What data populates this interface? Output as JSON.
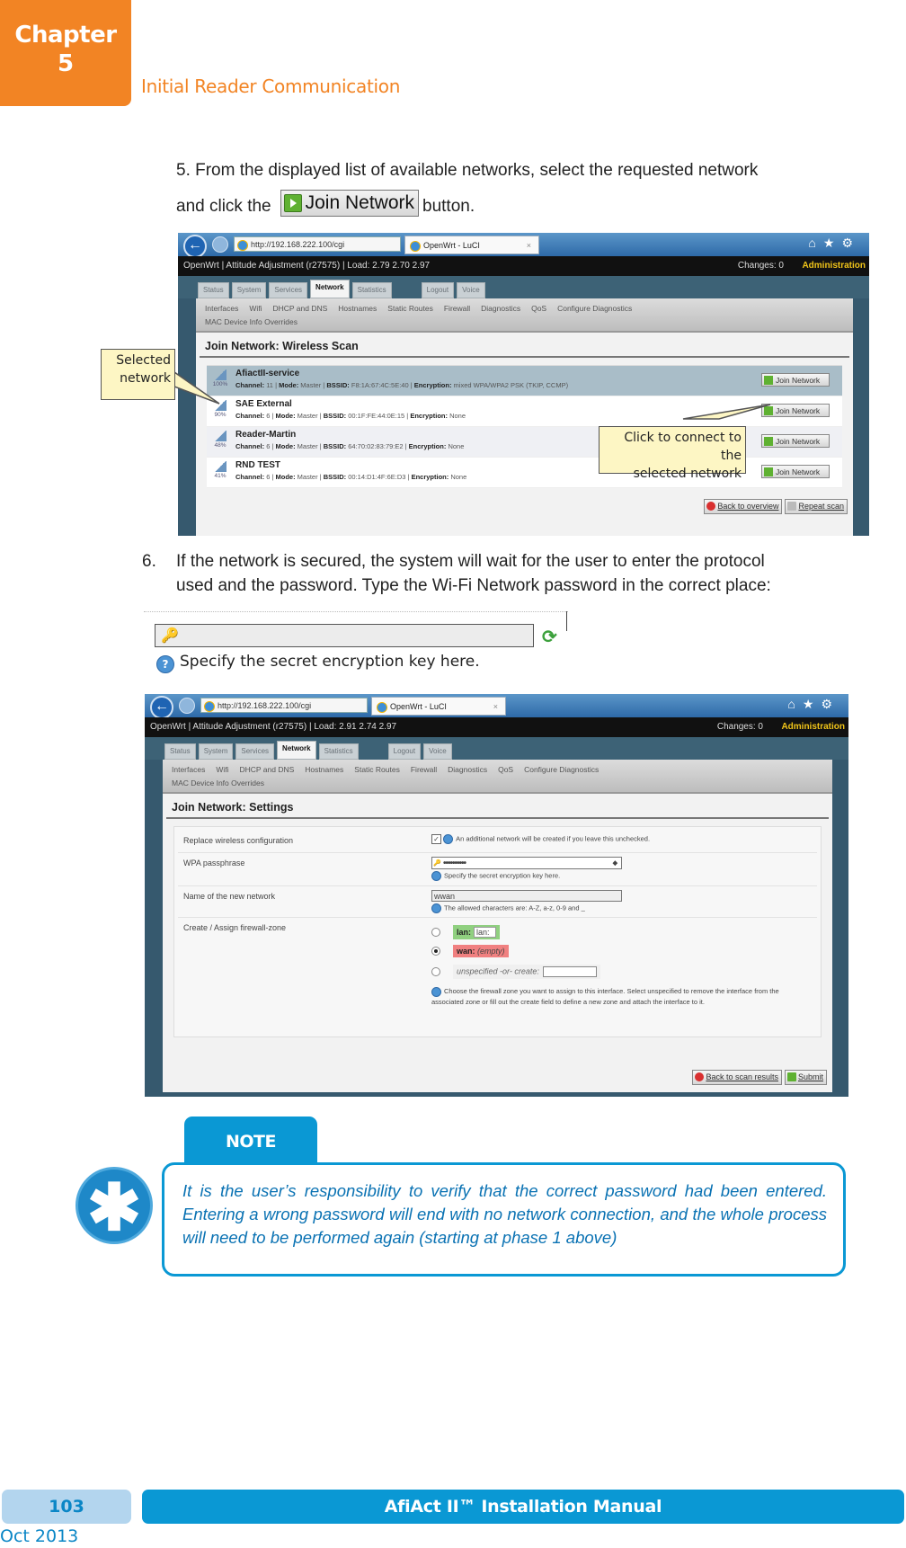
{
  "header": {
    "chapter_label": "Chapter",
    "chapter_number": "5",
    "section_title": "Initial Reader Communication"
  },
  "step5": {
    "text_line1": "5. From the displayed list of available networks, select the requested network",
    "text_before_button": "and click the",
    "button_label": "Join Network",
    "text_after_button": "button."
  },
  "scan_screenshot": {
    "browser": {
      "address": "http://192.168.222.100/cgi",
      "tab_title": "OpenWrt - LuCI",
      "tab_close": "×",
      "icons": [
        "home-icon",
        "star-icon",
        "gear-icon"
      ]
    },
    "status_bar": {
      "text": "OpenWrt | Attitude Adjustment (r27575) | Load: 2.79 2.70 2.97",
      "changes": "Changes: 0",
      "admin": "Administration"
    },
    "main_tabs": [
      "Status",
      "System",
      "Services",
      "Network",
      "Statistics",
      "Logout",
      "Voice"
    ],
    "active_tab": "Network",
    "subnav": [
      "Interfaces",
      "Wifi",
      "DHCP and DNS",
      "Hostnames",
      "Static Routes",
      "Firewall",
      "Diagnostics",
      "QoS",
      "Configure Diagnostics",
      "MAC Device Info Overrides"
    ],
    "page_title": "Join Network: Wireless Scan",
    "networks": [
      {
        "signal": "100%",
        "name": "AfiactII-service",
        "channel": "11",
        "mode": "Master",
        "bssid": "F8:1A:67:4C:5E:40",
        "encryption": "mixed WPA/WPA2 PSK (TKIP, CCMP)",
        "selected": true
      },
      {
        "signal": "90%",
        "name": "SAE External",
        "channel": "6",
        "mode": "Master",
        "bssid": "00:1F:FE:44:0E:15",
        "encryption": "None",
        "selected": false
      },
      {
        "signal": "48%",
        "name": "Reader-Martin",
        "channel": "6",
        "mode": "Master",
        "bssid": "64:70:02:83:79:E2",
        "encryption": "None",
        "selected": false
      },
      {
        "signal": "41%",
        "name": "RND TEST",
        "channel": "6",
        "mode": "Master",
        "bssid": "00:14:D1:4F:6E:D3",
        "encryption": "None",
        "selected": false
      }
    ],
    "labels": {
      "channel": "Channel:",
      "mode": "Mode:",
      "bssid": "BSSID:",
      "encryption": "Encryption:"
    },
    "join_button": "Join Network",
    "back_button": "Back to overview",
    "repeat_button": "Repeat scan",
    "callout_selected_line1": "Selected",
    "callout_selected_line2": "network",
    "callout_click_line1": "Click to connect to the",
    "callout_click_line2": "selected network"
  },
  "step6": {
    "number": "6.",
    "text_line1": "If the network is secured, the system will wait for the user to enter the protocol",
    "text_line2": "used and the password. Type the Wi-Fi Network password in the correct place:"
  },
  "key_snippet": {
    "help_text": "Specify the secret encryption key here."
  },
  "settings_screenshot": {
    "browser": {
      "address": "http://192.168.222.100/cgi",
      "tab_title": "OpenWrt - LuCI",
      "tab_close": "×"
    },
    "status_bar": {
      "text": "OpenWrt | Attitude Adjustment (r27575) | Load: 2.91 2.74 2.97",
      "changes": "Changes: 0",
      "admin": "Administration"
    },
    "main_tabs": [
      "Status",
      "System",
      "Services",
      "Network",
      "Statistics",
      "Logout",
      "Voice"
    ],
    "subnav": [
      "Interfaces",
      "Wifi",
      "DHCP and DNS",
      "Hostnames",
      "Static Routes",
      "Firewall",
      "Diagnostics",
      "QoS",
      "Configure Diagnostics",
      "MAC Device Info Overrides"
    ],
    "page_title": "Join Network: Settings",
    "fields": {
      "replace_label": "Replace wireless configuration",
      "replace_checked": true,
      "replace_hint": "An additional network will be created if you leave this unchecked.",
      "wpa_label": "WPA passphrase",
      "wpa_value": "••••••••••",
      "wpa_hint": "Specify the secret encryption key here.",
      "name_label": "Name of the new network",
      "name_value": "wwan",
      "name_hint": "The allowed characters are: A-Z, a-z, 0-9 and _",
      "zone_label": "Create / Assign firewall-zone",
      "zone_lan_name": "lan:",
      "zone_lan_value": "lan:",
      "zone_wan_name": "wan:",
      "zone_wan_value": "(empty)",
      "zone_unspec": "unspecified -or- create:",
      "zone_selected": "wan",
      "zone_hint": "Choose the firewall zone you want to assign to this interface. Select unspecified to remove the interface from the associated zone or fill out the create field to define a new zone and attach the interface to it."
    },
    "back_button": "Back to scan results",
    "submit_button": "Submit"
  },
  "note": {
    "tab_label": "NOTE",
    "text": "It is the user’s responsibility to verify that the correct password had been entered. Entering a wrong password will end with no network connection, and the whole process will need to be performed again (starting at phase 1 above)"
  },
  "footer": {
    "page_number": "103",
    "manual_title": "AfiAct II™ Installation Manual",
    "date": "Oct 2013"
  }
}
